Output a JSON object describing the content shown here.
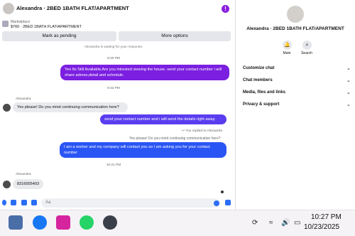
{
  "header": {
    "title": "Alexandra · 2BED 1BATH FLAT/APARTMENT",
    "info_glyph": "!"
  },
  "marketplace": {
    "label": "Marketplace",
    "listing": "$760 · 2BED 1BATH FLAT/APARTMENT"
  },
  "buttons": {
    "pending": "Mark as pending",
    "more": "More options"
  },
  "chat": {
    "notice": "Alexandra is waiting for your response.",
    "ts1": "8:20 PM",
    "msg1": "Yes Its Still Available,Are you intrested viewing the house. send your contact number i will share adress,detail and schedule.",
    "ts2": "9:42 PM",
    "sender1": "Alexandra",
    "msg2": "Yes please! Do you mind continuing communication here?",
    "msg3": "send your contact number and i will send the details right away.",
    "replied_note": "You replied to Alexandra",
    "quote": "Yes please! Do you mind continuing communication here?",
    "msg4": "I am a worker and my company will contact you so I am asking you for your contact number",
    "ts3": "10:21 PM",
    "sender2": "Alexandra",
    "msg5": "8316005403"
  },
  "composer": {
    "placeholder": "Aa"
  },
  "panel": {
    "title": "Alexandra · 2BED 1BATH FLAT/APARTMENT",
    "mute": "Mute",
    "search": "Search",
    "menu": [
      "Customize chat",
      "Chat members",
      "Media, files and links",
      "Privacy & support"
    ]
  },
  "taskbar": {
    "time": "10:27 PM",
    "date": "10/23/2025"
  },
  "colors": {
    "accent_purple": "#7b1fe0",
    "accent_blue": "#2a55f5"
  }
}
